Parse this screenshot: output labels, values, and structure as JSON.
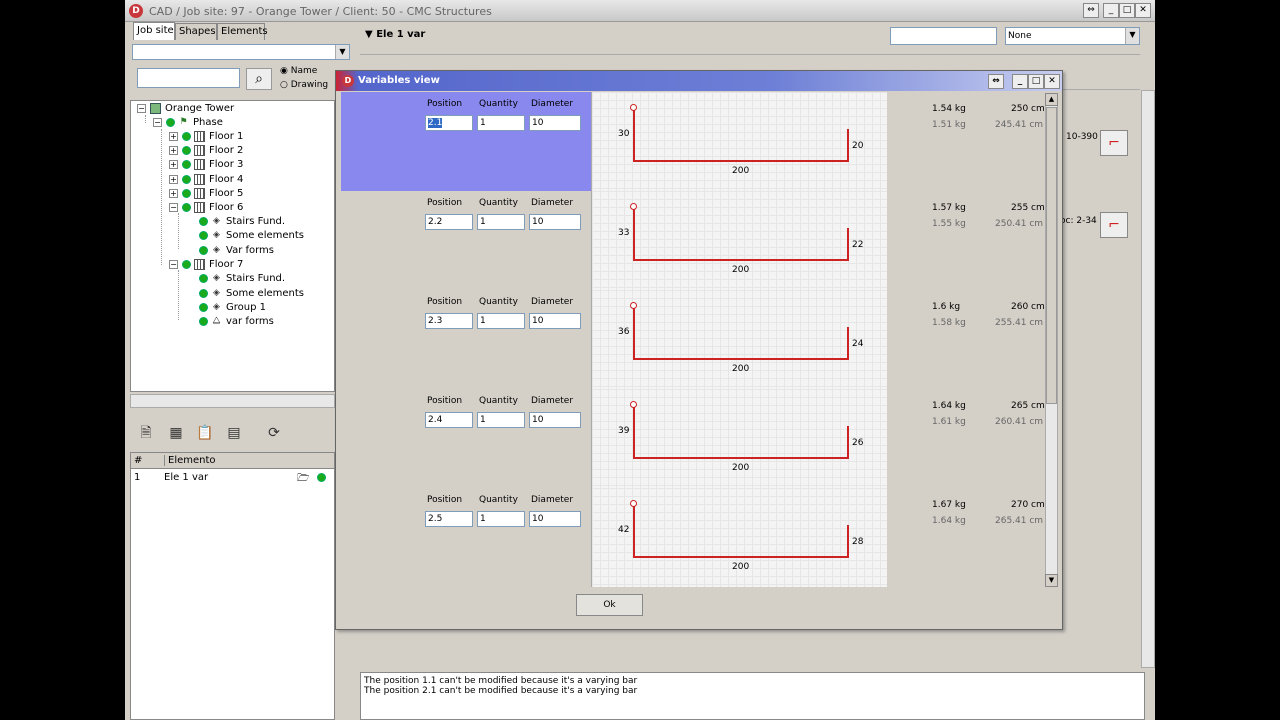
{
  "window": {
    "title": "CAD / Job site: 97 - Orange Tower / Client: 50 - CMC Structures"
  },
  "left_panel": {
    "tabs": [
      "Job site",
      "Shapes",
      "Elements"
    ],
    "search_placeholder": "",
    "radio": [
      {
        "label": "Name",
        "selected": true
      },
      {
        "label": "Drawing",
        "selected": false
      }
    ],
    "tree": {
      "root": "Orange Tower",
      "phase": "Phase",
      "floors": [
        "Floor 1",
        "Floor 2",
        "Floor 3",
        "Floor 4",
        "Floor 5",
        "Floor 6",
        "Floor 7"
      ],
      "floor6_children": [
        "Stairs  Fund.",
        "Some  elements",
        "Var forms"
      ],
      "floor7_children": [
        "Stairs  Fund.",
        "Some  elements",
        "Group 1",
        "var forms"
      ]
    },
    "element_list": {
      "headers": [
        "#",
        "Elemento"
      ],
      "rows": [
        {
          "num": "1",
          "name": "Ele 1 var"
        }
      ]
    }
  },
  "main": {
    "element_title": "Ele 1 var",
    "filter_select": "None",
    "side_labels": [
      "10-390",
      "oc: 2-34"
    ]
  },
  "messages": [
    "The position 1.1 can't be modified because it's a varying bar",
    "The position 2.1 can't be modified because it's a varying bar"
  ],
  "dialog": {
    "title": "Variables view",
    "col_labels": {
      "position": "Position",
      "quantity": "Quantity",
      "diameter": "Diameter"
    },
    "ok_label": "Ok",
    "rows": [
      {
        "position": "2.1",
        "quantity": "1",
        "diameter": "10",
        "left_leg": "30",
        "right_leg": "20",
        "length": "200",
        "kg1": "1.54 kg",
        "kg2": "1.51 kg",
        "cm1": "250 cm",
        "cm2": "245.41 cm",
        "selected": true
      },
      {
        "position": "2.2",
        "quantity": "1",
        "diameter": "10",
        "left_leg": "33",
        "right_leg": "22",
        "length": "200",
        "kg1": "1.57 kg",
        "kg2": "1.55 kg",
        "cm1": "255 cm",
        "cm2": "250.41 cm",
        "selected": false
      },
      {
        "position": "2.3",
        "quantity": "1",
        "diameter": "10",
        "left_leg": "36",
        "right_leg": "24",
        "length": "200",
        "kg1": "1.6 kg",
        "kg2": "1.58 kg",
        "cm1": "260 cm",
        "cm2": "255.41 cm",
        "selected": false
      },
      {
        "position": "2.4",
        "quantity": "1",
        "diameter": "10",
        "left_leg": "39",
        "right_leg": "26",
        "length": "200",
        "kg1": "1.64 kg",
        "kg2": "1.61 kg",
        "cm1": "265 cm",
        "cm2": "260.41 cm",
        "selected": false
      },
      {
        "position": "2.5",
        "quantity": "1",
        "diameter": "10",
        "left_leg": "42",
        "right_leg": "28",
        "length": "200",
        "kg1": "1.67 kg",
        "kg2": "1.64 kg",
        "cm1": "270 cm",
        "cm2": "265.41 cm",
        "selected": false
      }
    ]
  },
  "colors": {
    "selection": "#8888ee",
    "bar": "#cc2222",
    "accent": "#c8373b"
  }
}
